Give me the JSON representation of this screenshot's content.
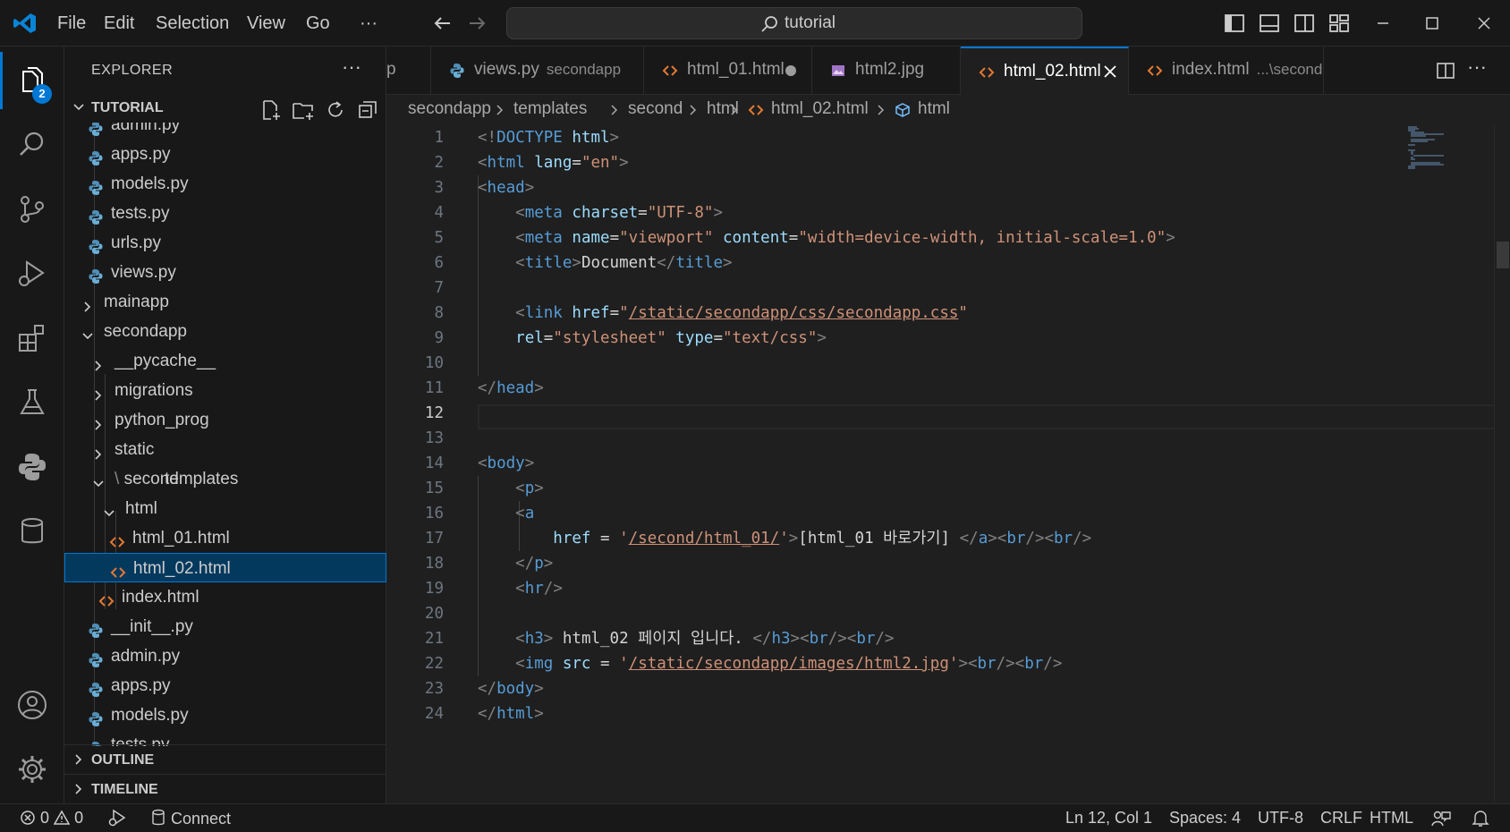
{
  "titlebar": {
    "menu": [
      "File",
      "Edit",
      "Selection",
      "View",
      "Go",
      "···"
    ],
    "search": "tutorial"
  },
  "activitybar": {
    "explorer_badge": "2"
  },
  "sidebar": {
    "title": "EXPLORER",
    "section": "TUTORIAL",
    "outline": "OUTLINE",
    "timeline": "TIMELINE",
    "tree": [
      {
        "label": "admin.py",
        "kind": "py"
      },
      {
        "label": "apps.py",
        "kind": "py"
      },
      {
        "label": "models.py",
        "kind": "py"
      },
      {
        "label": "tests.py",
        "kind": "py"
      },
      {
        "label": "urls.py",
        "kind": "py"
      },
      {
        "label": "views.py",
        "kind": "py"
      },
      {
        "label": "mainapp",
        "kind": "folder-closed"
      },
      {
        "label": "secondapp",
        "kind": "folder-open"
      },
      {
        "label": "__pycache__",
        "kind": "folder-closed"
      },
      {
        "label": "migrations",
        "kind": "folder-closed"
      },
      {
        "label": "python_prog",
        "kind": "folder-closed"
      },
      {
        "label": "static",
        "kind": "folder-closed"
      },
      {
        "label": "templates",
        "label2": "second",
        "kind": "folder-open"
      },
      {
        "label": "html",
        "kind": "folder-open"
      },
      {
        "label": "html_01.html",
        "kind": "html"
      },
      {
        "label": "html_02.html",
        "kind": "html",
        "selected": true
      },
      {
        "label": "index.html",
        "kind": "html"
      },
      {
        "label": "__init__.py",
        "kind": "py"
      },
      {
        "label": "admin.py",
        "kind": "py"
      },
      {
        "label": "apps.py",
        "kind": "py"
      },
      {
        "label": "models.py",
        "kind": "py"
      },
      {
        "label": "tests.py",
        "kind": "py"
      }
    ]
  },
  "tabs": [
    {
      "label": "p",
      "desc": "",
      "kind": "partial"
    },
    {
      "label": "views.py",
      "desc": "secondapp",
      "kind": "py"
    },
    {
      "label": "html_01.html",
      "desc": "",
      "kind": "html",
      "dirty": true
    },
    {
      "label": "html2.jpg",
      "desc": "",
      "kind": "img"
    },
    {
      "label": "html_02.html",
      "desc": "",
      "kind": "html",
      "active": true
    },
    {
      "label": "index.html",
      "desc": "...\\second",
      "kind": "html"
    }
  ],
  "breadcrumb": [
    "secondapp",
    "templates",
    "second",
    "html",
    "html_02.html",
    "html"
  ],
  "editor": {
    "current_line": 12,
    "lines": [
      "1",
      "2",
      "3",
      "4",
      "5",
      "6",
      "7",
      "8",
      "9",
      "10",
      "11",
      "12",
      "13",
      "14",
      "15",
      "16",
      "17",
      "18",
      "19",
      "20",
      "21",
      "22",
      "23",
      "24"
    ],
    "code": {
      "l17_text": "[html_01 바로가기]",
      "l21_text": "html_02 페이지 입니다."
    }
  },
  "status": {
    "errors": "0",
    "warnings": "0",
    "connect": "Connect",
    "position": "Ln 12, Col 1",
    "spaces": "Spaces: 4",
    "encoding": "UTF-8",
    "eol": "CRLF",
    "language": "HTML"
  },
  "colors": {
    "accent": "#0078d4",
    "tag": "#569cd6",
    "attr": "#9cdcfe",
    "string": "#ce9178",
    "html_icon": "#e37933",
    "python_icon": "#519aba"
  }
}
